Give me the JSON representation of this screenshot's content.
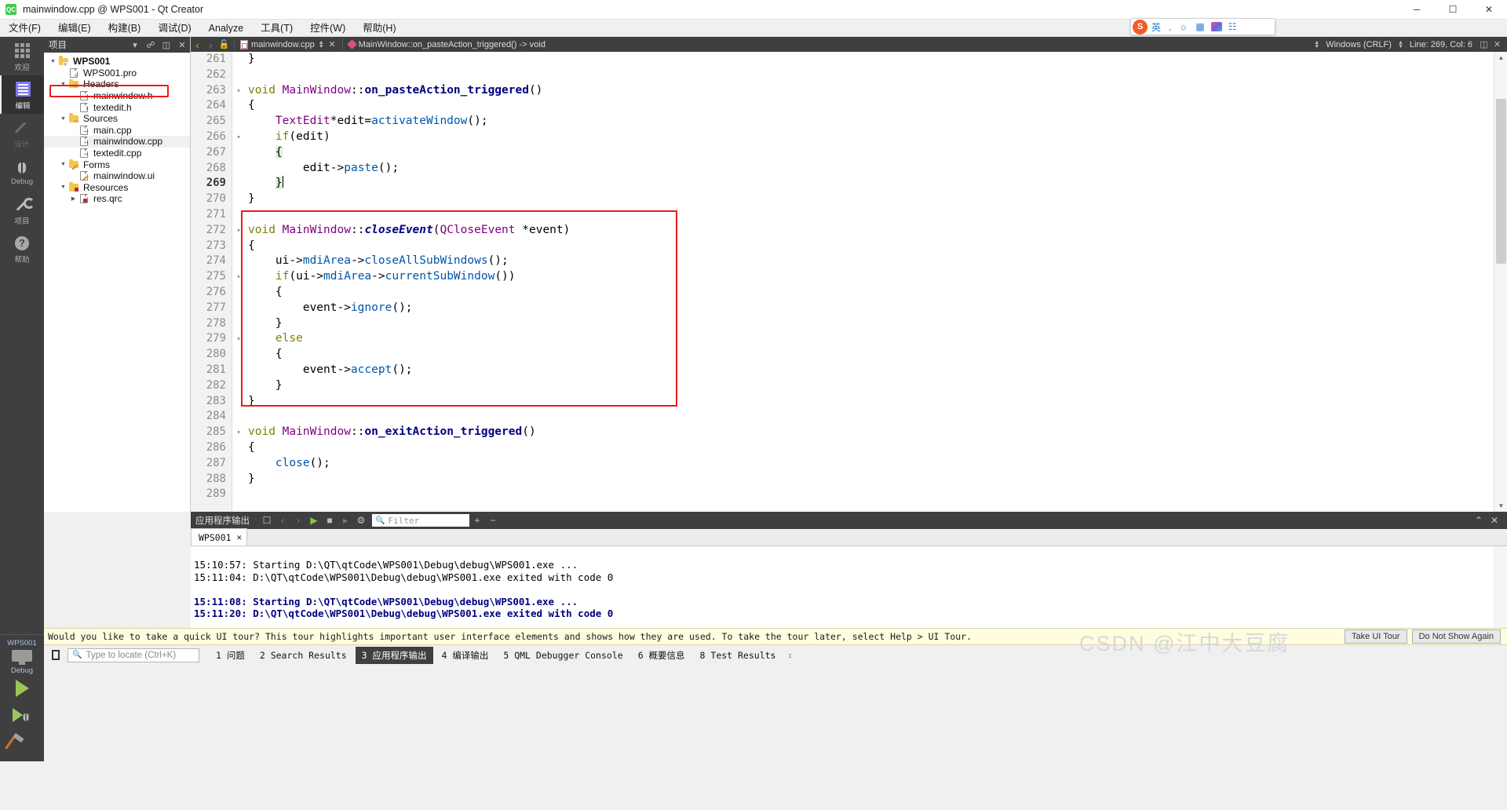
{
  "window": {
    "title": "mainwindow.cpp @ WPS001 - Qt Creator",
    "logo_text": "QC",
    "minimize": "─",
    "maximize": "☐",
    "close": "✕"
  },
  "menubar": [
    {
      "label": "文件(F)",
      "name": "menu-file"
    },
    {
      "label": "编辑(E)",
      "name": "menu-edit"
    },
    {
      "label": "构建(B)",
      "name": "menu-build"
    },
    {
      "label": "调试(D)",
      "name": "menu-debug"
    },
    {
      "label": "Analyze",
      "name": "menu-analyze"
    },
    {
      "label": "工具(T)",
      "name": "menu-tools"
    },
    {
      "label": "控件(W)",
      "name": "menu-window"
    },
    {
      "label": "帮助(H)",
      "name": "menu-help"
    }
  ],
  "modebar": {
    "items": [
      {
        "label": "欢迎",
        "icon": "grid-icon",
        "state": "normal"
      },
      {
        "label": "编辑",
        "icon": "edit-icon",
        "state": "active"
      },
      {
        "label": "设计",
        "icon": "pencil-icon",
        "state": "disabled"
      },
      {
        "label": "Debug",
        "icon": "bug-icon",
        "state": "normal"
      },
      {
        "label": "项目",
        "icon": "wrench-icon",
        "state": "normal"
      },
      {
        "label": "帮助",
        "icon": "help-icon",
        "state": "normal"
      }
    ],
    "kit": {
      "project": "WPS001",
      "config": "Debug"
    },
    "run_buttons": [
      {
        "name": "run-button",
        "icon": "play-icon"
      },
      {
        "name": "debug-button",
        "icon": "play-bug-icon"
      },
      {
        "name": "build-button",
        "icon": "hammer-icon"
      }
    ]
  },
  "project_panel": {
    "header_title": "项目",
    "header_buttons": [
      "filter-icon",
      "link-icon",
      "split-icon",
      "close-icon"
    ],
    "tree": [
      {
        "label": "WPS001",
        "indent": 0,
        "arrow": "▼",
        "icon": "folder-qt",
        "bold": true,
        "selected": false
      },
      {
        "label": "WPS001.pro",
        "indent": 1,
        "arrow": "",
        "icon": "file-pro",
        "bold": false,
        "selected": false
      },
      {
        "label": "Headers",
        "indent": 1,
        "arrow": "▼",
        "icon": "folder-h",
        "bold": false,
        "selected": false
      },
      {
        "label": "mainwindow.h",
        "indent": 2,
        "arrow": "",
        "icon": "file-h",
        "bold": false,
        "selected": false
      },
      {
        "label": "textedit.h",
        "indent": 2,
        "arrow": "",
        "icon": "file-h",
        "bold": false,
        "selected": false
      },
      {
        "label": "Sources",
        "indent": 1,
        "arrow": "▼",
        "icon": "folder-cpp",
        "bold": false,
        "selected": false
      },
      {
        "label": "main.cpp",
        "indent": 2,
        "arrow": "",
        "icon": "file-cpp",
        "bold": false,
        "selected": false
      },
      {
        "label": "mainwindow.cpp",
        "indent": 2,
        "arrow": "",
        "icon": "file-cpp",
        "bold": false,
        "selected": true
      },
      {
        "label": "textedit.cpp",
        "indent": 2,
        "arrow": "",
        "icon": "file-cpp",
        "bold": false,
        "selected": false
      },
      {
        "label": "Forms",
        "indent": 1,
        "arrow": "▼",
        "icon": "folder-ui",
        "bold": false,
        "selected": false
      },
      {
        "label": "mainwindow.ui",
        "indent": 2,
        "arrow": "",
        "icon": "file-ui",
        "bold": false,
        "selected": false
      },
      {
        "label": "Resources",
        "indent": 1,
        "arrow": "▼",
        "icon": "folder-res",
        "bold": false,
        "selected": false
      },
      {
        "label": "res.qrc",
        "indent": 2,
        "arrow": "▶",
        "icon": "file-qrc",
        "bold": false,
        "selected": false
      }
    ]
  },
  "editor_toolbar": {
    "nav_back": "‹",
    "nav_forward": "›",
    "lock_icon": "unlock-icon",
    "file_combo": "mainwindow.cpp",
    "close_doc": "✕",
    "symbol_combo": "MainWindow::on_pasteAction_triggered() -> void",
    "line_ending": "Windows (CRLF)",
    "cursor_position": "Line: 269, Col: 6"
  },
  "code": {
    "first_line": 261,
    "current_line": 269,
    "lines": [
      {
        "n": 261,
        "fold": "",
        "html": "<span class=\"pl\">}</span>"
      },
      {
        "n": 262,
        "fold": "",
        "html": ""
      },
      {
        "n": 263,
        "fold": "▾",
        "html": "<span class=\"kw\">void</span> <span class=\"cls\">MainWindow</span><span class=\"pl\">::</span><span class=\"fn\">on_pasteAction_triggered</span><span class=\"pl\">()</span>"
      },
      {
        "n": 264,
        "fold": "",
        "html": "<span class=\"pl\">{</span>"
      },
      {
        "n": 265,
        "fold": "",
        "html": "    <span class=\"cls\">TextEdit</span><span class=\"pl\">*edit=</span><span class=\"mem\">activateWindow</span><span class=\"pl\">();</span>"
      },
      {
        "n": 266,
        "fold": "▾",
        "html": "    <span class=\"kw\">if</span><span class=\"pl\">(edit)</span>"
      },
      {
        "n": 267,
        "fold": "",
        "html": "    <span class=\"brmatch\">{</span>"
      },
      {
        "n": 268,
        "fold": "",
        "html": "        <span class=\"pl\">edit-&gt;</span><span class=\"mem\">paste</span><span class=\"pl\">();</span>"
      },
      {
        "n": 269,
        "fold": "",
        "html": "    <span class=\"brmatch\">}</span><span class=\"caret\"></span>"
      },
      {
        "n": 270,
        "fold": "",
        "html": "<span class=\"pl\">}</span>"
      },
      {
        "n": 271,
        "fold": "",
        "html": ""
      },
      {
        "n": 272,
        "fold": "▾",
        "html": "<span class=\"kw\">void</span> <span class=\"cls\">MainWindow</span><span class=\"pl\">::</span><span class=\"fni\">closeEvent</span><span class=\"pl\">(</span><span class=\"cls\">QCloseEvent</span> <span class=\"pl\">*event)</span>"
      },
      {
        "n": 273,
        "fold": "",
        "html": "<span class=\"pl\">{</span>"
      },
      {
        "n": 274,
        "fold": "",
        "html": "    <span class=\"pl\">ui-&gt;</span><span class=\"mem\">mdiArea</span><span class=\"pl\">-&gt;</span><span class=\"mem\">closeAllSubWindows</span><span class=\"pl\">();</span>"
      },
      {
        "n": 275,
        "fold": "▾",
        "html": "    <span class=\"kw\">if</span><span class=\"pl\">(ui-&gt;</span><span class=\"mem\">mdiArea</span><span class=\"pl\">-&gt;</span><span class=\"mem\">currentSubWindow</span><span class=\"pl\">())</span>"
      },
      {
        "n": 276,
        "fold": "",
        "html": "    <span class=\"pl\">{</span>"
      },
      {
        "n": 277,
        "fold": "",
        "html": "        <span class=\"pl\">event-&gt;</span><span class=\"mem\">ignore</span><span class=\"pl\">();</span>"
      },
      {
        "n": 278,
        "fold": "",
        "html": "    <span class=\"pl\">}</span>"
      },
      {
        "n": 279,
        "fold": "▾",
        "html": "    <span class=\"kw\">else</span>"
      },
      {
        "n": 280,
        "fold": "",
        "html": "    <span class=\"pl\">{</span>"
      },
      {
        "n": 281,
        "fold": "",
        "html": "        <span class=\"pl\">event-&gt;</span><span class=\"mem\">accept</span><span class=\"pl\">();</span>"
      },
      {
        "n": 282,
        "fold": "",
        "html": "    <span class=\"pl\">}</span>"
      },
      {
        "n": 283,
        "fold": "",
        "html": "<span class=\"pl\">}</span>"
      },
      {
        "n": 284,
        "fold": "",
        "html": ""
      },
      {
        "n": 285,
        "fold": "▾",
        "html": "<span class=\"kw\">void</span> <span class=\"cls\">MainWindow</span><span class=\"pl\">::</span><span class=\"fn\">on_exitAction_triggered</span><span class=\"pl\">()</span>"
      },
      {
        "n": 286,
        "fold": "",
        "html": "<span class=\"pl\">{</span>"
      },
      {
        "n": 287,
        "fold": "",
        "html": "    <span class=\"mem\">close</span><span class=\"pl\">();</span>"
      },
      {
        "n": 288,
        "fold": "",
        "html": "<span class=\"pl\">}</span>"
      },
      {
        "n": 289,
        "fold": "",
        "html": ""
      }
    ]
  },
  "output_pane": {
    "title": "应用程序输出",
    "filter_placeholder": "Filter",
    "toolbar_icons": [
      "clear-icon",
      "prev-icon",
      "next-icon",
      "run-icon",
      "stop-icon",
      "attach-icon",
      "settings-icon"
    ],
    "add_label": "+",
    "remove_label": "−",
    "minimize_label": "⌃",
    "close_label": "✕",
    "tabs": [
      {
        "label": "WPS001",
        "close": "✕",
        "active": true
      }
    ],
    "lines": [
      {
        "text": "15:10:57: Starting D:\\QT\\qtCode\\WPS001\\Debug\\debug\\WPS001.exe ...",
        "bold": false
      },
      {
        "text": "15:11:04: D:\\QT\\qtCode\\WPS001\\Debug\\debug\\WPS001.exe exited with code 0",
        "bold": false
      },
      {
        "text": "",
        "bold": false
      },
      {
        "text": "15:11:08: Starting D:\\QT\\qtCode\\WPS001\\Debug\\debug\\WPS001.exe ...",
        "bold": true
      },
      {
        "text": "15:11:20: D:\\QT\\qtCode\\WPS001\\Debug\\debug\\WPS001.exe exited with code 0",
        "bold": true
      }
    ]
  },
  "tour_banner": {
    "message": "Would you like to take a quick UI tour? This tour highlights important user interface elements and shows how they are used. To take the tour later, select Help > UI Tour.",
    "take_tour_label": "Take UI Tour",
    "do_not_show_label": "Do Not Show Again"
  },
  "statusbar": {
    "locator_icon": "sidebar-toggle-icon",
    "locator_placeholder": "Type to locate (Ctrl+K)",
    "tabs": [
      {
        "num": "1",
        "label": "问题",
        "active": false
      },
      {
        "num": "2",
        "label": "Search Results",
        "active": false
      },
      {
        "num": "3",
        "label": "应用程序输出",
        "active": true
      },
      {
        "num": "4",
        "label": "编译输出",
        "active": false
      },
      {
        "num": "5",
        "label": "QML Debugger Console",
        "active": false
      },
      {
        "num": "6",
        "label": "概要信息",
        "active": false
      },
      {
        "num": "8",
        "label": "Test Results",
        "active": false
      }
    ],
    "expander": "↕"
  },
  "ime_toolbar": {
    "logo": "S",
    "mode_label": "英",
    "icons": [
      "comma-icon",
      "mic-icon",
      "keyboard-icon",
      "skin-icon",
      "apps-icon"
    ]
  },
  "watermark": "CSDN @江中大豆腐",
  "colors": {
    "highlight_red": "#ef1a1a",
    "accent_green": "#41cd52",
    "dark_panel": "#3f3f3f",
    "keyword": "#808000",
    "class_name": "#800080",
    "function": "#000080",
    "member": "#0055aa"
  }
}
